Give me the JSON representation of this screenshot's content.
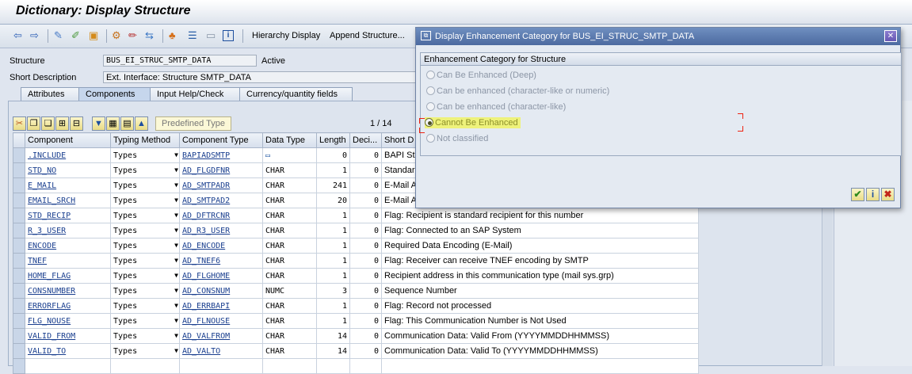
{
  "window": {
    "title": "Dictionary: Display Structure"
  },
  "toolbar": {
    "icons": [
      "back-icon",
      "forward-icon",
      "other-object-icon",
      "display-change-icon",
      "activate-icon",
      "check-icon",
      "where-used-icon",
      "object-list-icon",
      "navigate-icon",
      "hierarchy-icon",
      "table-icon",
      "info-icon"
    ],
    "hierarchy_display": "Hierarchy Display",
    "append_structure": "Append Structure..."
  },
  "header": {
    "structure_label": "Structure",
    "structure_value": "BUS_EI_STRUC_SMTP_DATA",
    "status": "Active",
    "short_desc_label": "Short Description",
    "short_desc_value": "Ext. Interface: Structure SMTP_DATA"
  },
  "tabs": [
    "Attributes",
    "Components",
    "Input Help/Check",
    "Currency/quantity fields"
  ],
  "grid": {
    "predefined_type": "Predefined Type",
    "pager": "1 / 14",
    "columns": [
      "Component",
      "Typing Method",
      "Component Type",
      "Data Type",
      "Length",
      "Deci...",
      "Short D"
    ],
    "rows": [
      {
        "component": ".INCLUDE",
        "typing": "Types",
        "ctype": "BAPIADSMTP",
        "dtype": "",
        "length": "0",
        "dec": "0",
        "desc": "BAPI St"
      },
      {
        "component": "STD_NO",
        "typing": "Types",
        "ctype": "AD_FLGDFNR",
        "dtype": "CHAR",
        "length": "1",
        "dec": "0",
        "desc": "Standar"
      },
      {
        "component": "E_MAIL",
        "typing": "Types",
        "ctype": "AD_SMTPADR",
        "dtype": "CHAR",
        "length": "241",
        "dec": "0",
        "desc": "E-Mail A"
      },
      {
        "component": "EMAIL_SRCH",
        "typing": "Types",
        "ctype": "AD_SMTPAD2",
        "dtype": "CHAR",
        "length": "20",
        "dec": "0",
        "desc": "E-Mail A"
      },
      {
        "component": "STD_RECIP",
        "typing": "Types",
        "ctype": "AD_DFTRCNR",
        "dtype": "CHAR",
        "length": "1",
        "dec": "0",
        "desc": "Flag: Recipient is standard recipient for this number"
      },
      {
        "component": "R_3_USER",
        "typing": "Types",
        "ctype": "AD_R3_USER",
        "dtype": "CHAR",
        "length": "1",
        "dec": "0",
        "desc": "Flag: Connected to an SAP System"
      },
      {
        "component": "ENCODE",
        "typing": "Types",
        "ctype": "AD_ENCODE",
        "dtype": "CHAR",
        "length": "1",
        "dec": "0",
        "desc": "Required Data Encoding (E-Mail)"
      },
      {
        "component": "TNEF",
        "typing": "Types",
        "ctype": "AD_TNEF6",
        "dtype": "CHAR",
        "length": "1",
        "dec": "0",
        "desc": "Flag: Receiver can receive TNEF encoding by SMTP"
      },
      {
        "component": "HOME_FLAG",
        "typing": "Types",
        "ctype": "AD_FLGHOME",
        "dtype": "CHAR",
        "length": "1",
        "dec": "0",
        "desc": "Recipient address in this communication type (mail sys.grp)"
      },
      {
        "component": "CONSNUMBER",
        "typing": "Types",
        "ctype": "AD_CONSNUM",
        "dtype": "NUMC",
        "length": "3",
        "dec": "0",
        "desc": "Sequence Number"
      },
      {
        "component": "ERRORFLAG",
        "typing": "Types",
        "ctype": "AD_ERRBAPI",
        "dtype": "CHAR",
        "length": "1",
        "dec": "0",
        "desc": "Flag: Record not processed"
      },
      {
        "component": "FLG_NOUSE",
        "typing": "Types",
        "ctype": "AD_FLNOUSE",
        "dtype": "CHAR",
        "length": "1",
        "dec": "0",
        "desc": "Flag: This Communication Number is Not Used"
      },
      {
        "component": "VALID_FROM",
        "typing": "Types",
        "ctype": "AD_VALFROM",
        "dtype": "CHAR",
        "length": "14",
        "dec": "0",
        "desc": "Communication Data: Valid From (YYYYMMDDHHMMSS)"
      },
      {
        "component": "VALID_TO",
        "typing": "Types",
        "ctype": "AD_VALTO",
        "dtype": "CHAR",
        "length": "14",
        "dec": "0",
        "desc": "Communication Data: Valid To (YYYYMMDDHHMMSS)"
      }
    ]
  },
  "dialog": {
    "title": "Display Enhancement Category for BUS_EI_STRUC_SMTP_DATA",
    "group_title": "Enhancement Category for Structure",
    "options": [
      {
        "label": "Can Be Enhanced (Deep)",
        "checked": false
      },
      {
        "label": "Can be enhanced (character-like or numeric)",
        "checked": false
      },
      {
        "label": "Can be enhanced (character-like)",
        "checked": false
      },
      {
        "label": "Cannot Be Enhanced",
        "checked": true
      },
      {
        "label": "Not classified",
        "checked": false
      }
    ],
    "buttons": [
      "confirm-icon",
      "info-icon",
      "cancel-icon"
    ]
  },
  "colors": {
    "highlight": "#eef27b",
    "title_bar": "#4c6aa0",
    "link": "#1a3f8f"
  }
}
